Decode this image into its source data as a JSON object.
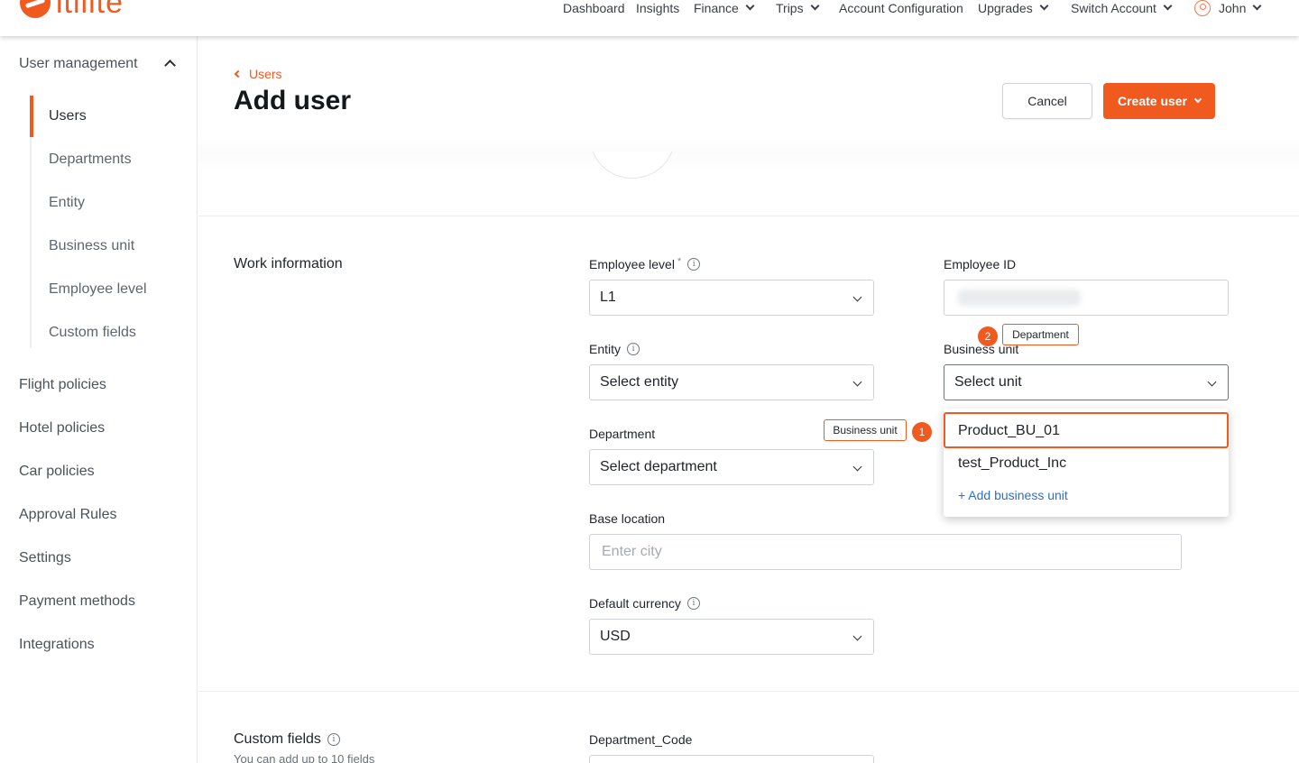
{
  "brand": {
    "logo_text": "itilite"
  },
  "topnav": {
    "items": [
      {
        "label": "Dashboard"
      },
      {
        "label": "Insights"
      },
      {
        "label": "Finance"
      },
      {
        "label": "Trips"
      },
      {
        "label": "Account Configuration"
      },
      {
        "label": "Upgrades"
      },
      {
        "label": "Switch Account"
      }
    ],
    "user": {
      "name": "John"
    }
  },
  "sidebar": {
    "group_label": "User management",
    "sub_items": [
      {
        "label": "Users"
      },
      {
        "label": "Departments"
      },
      {
        "label": "Entity"
      },
      {
        "label": "Business unit"
      },
      {
        "label": "Employee level"
      },
      {
        "label": "Custom fields"
      }
    ],
    "main_items": [
      {
        "label": "Flight policies"
      },
      {
        "label": "Hotel policies"
      },
      {
        "label": "Car policies"
      },
      {
        "label": "Approval Rules"
      },
      {
        "label": "Settings"
      },
      {
        "label": "Payment methods"
      },
      {
        "label": "Integrations"
      }
    ]
  },
  "header": {
    "breadcrumb": "Users",
    "title": "Add user",
    "cancel_label": "Cancel",
    "create_label": "Create user"
  },
  "work_info": {
    "section_title": "Work information",
    "employee_level": {
      "label": "Employee level",
      "required_mark": "*",
      "value": "L1"
    },
    "employee_id": {
      "label": "Employee ID"
    },
    "entity": {
      "label": "Entity",
      "value": "Select entity"
    },
    "business_unit": {
      "label": "Business unit",
      "value": "Select unit"
    },
    "department": {
      "label": "Department",
      "value": "Select department"
    },
    "base_location": {
      "label": "Base location",
      "placeholder": "Enter city"
    },
    "default_currency": {
      "label": "Default currency",
      "value": "USD"
    }
  },
  "business_unit_dropdown": {
    "options": [
      {
        "label": "Product_BU_01"
      },
      {
        "label": "test_Product_Inc"
      }
    ],
    "add_label": "+ Add business unit"
  },
  "custom_fields": {
    "section_title": "Custom fields",
    "subtitle": "You can add up to 10 fields",
    "department_code_label": "Department_Code"
  },
  "annotations": [
    {
      "number": "1",
      "text": "Business unit"
    },
    {
      "number": "2",
      "text": "Department"
    }
  ],
  "colors": {
    "accent": "#f05a1f",
    "link": "#2f6fcc"
  }
}
